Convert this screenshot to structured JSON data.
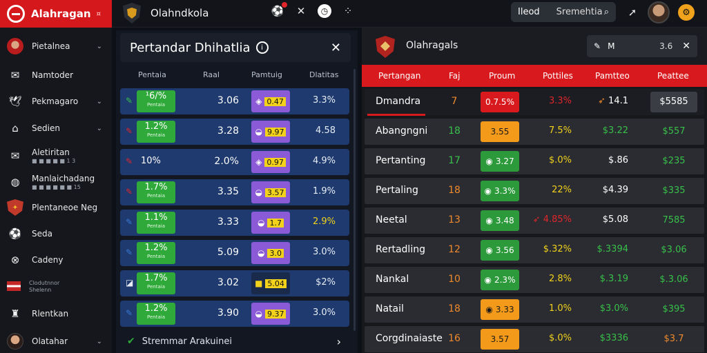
{
  "topbar": {
    "brand": "Alahragan",
    "brand_mark": "¤",
    "app_title": "Olahndkola",
    "search_left": "Ileod",
    "search_right": "Sremehtia"
  },
  "sidebar": {
    "items": [
      {
        "label": "Pietalnea",
        "sub": "",
        "icon": "avatar-icon",
        "chev": "⌄"
      },
      {
        "label": "Namtoder",
        "sub": "",
        "icon": "mail-icon",
        "chev": ""
      },
      {
        "label": "Pekmagaro",
        "sub": "",
        "icon": "bird-icon",
        "chev": "⌄"
      },
      {
        "label": "Sedien",
        "sub": "",
        "icon": "building-icon",
        "chev": "⌄"
      },
      {
        "label": "Aletiritan",
        "sub": "■ ■ ■ ■ ■ 1 3",
        "icon": "mail-icon",
        "chev": ""
      },
      {
        "label": "Manlaichadang",
        "sub": "■ ■ ■ ■ ■ ■ 15",
        "icon": "globe-icon",
        "chev": ""
      },
      {
        "label": "Plentaneoe Neg",
        "sub": "",
        "icon": "shield-icon",
        "chev": ""
      },
      {
        "label": "Seda",
        "sub": "",
        "icon": "soccer-icon",
        "chev": ""
      },
      {
        "label": "Cadeny",
        "sub": "",
        "icon": "cross-icon",
        "chev": ""
      },
      {
        "label": "Clodutnnor",
        "sub": "Shelenn",
        "icon": "flag-icon",
        "chev": ""
      },
      {
        "label": "Rlentkan",
        "sub": "",
        "icon": "chef-icon",
        "chev": ""
      },
      {
        "label": "Olatahar",
        "sub": "",
        "icon": "player-icon",
        "chev": "⌄"
      }
    ]
  },
  "left_panel": {
    "title": "Pertandar Dhihatlia",
    "columns": [
      "Pentaia",
      "Raal",
      "Pamtuig",
      "Dlatitas"
    ],
    "rows": [
      {
        "a": "¹6/%",
        "a_sub": "Pentaia",
        "b": "3.06",
        "c": "0.47",
        "d": "3.3%"
      },
      {
        "a": "1.2%",
        "a_sub": "Pentaia",
        "b": "3.28",
        "c": "9.97",
        "d": "4.58"
      },
      {
        "a": "10%",
        "a_sub": "",
        "b": "2.0%",
        "c": "0.97",
        "d": "4.9%"
      },
      {
        "a": "1.7%",
        "a_sub": "Pentaia",
        "b": "3.35",
        "c": "3.57",
        "d": "1.9%"
      },
      {
        "a": "1.1%",
        "a_sub": "Pentaia",
        "b": "3.33",
        "c": "1.7",
        "d": "2.9%"
      },
      {
        "a": "1.2%",
        "a_sub": "Pentaia",
        "b": "5.09",
        "c": "3.0",
        "d": "3.0%"
      },
      {
        "a": "1.7%",
        "a_sub": "Pentaia",
        "b": "3.02",
        "c": "5.04",
        "d": "$2%"
      },
      {
        "a": "1.2%",
        "a_sub": "Pentaia",
        "b": "3.90",
        "c": "9.37",
        "d": "3.0%"
      }
    ],
    "footer": "Stremmar Arakuinei"
  },
  "right_panel": {
    "title": "Olahragals",
    "search_m": "M",
    "search_value": "3.6",
    "columns": [
      "Pertangan",
      "Faj",
      "Proum",
      "Pottiles",
      "Pamtteo",
      "Peattee"
    ],
    "rows": [
      {
        "name": "Dmandra",
        "n": "7",
        "box": "0.7.5%",
        "box_style": "red",
        "c4": "3.3%",
        "c5": "14.1",
        "c6": "$5585"
      },
      {
        "name": "Abangngni",
        "n": "18",
        "box": "3.55",
        "box_style": "orange",
        "c4": "7.5%",
        "c5": "$3.22",
        "c6": "$557"
      },
      {
        "name": "Pertanting",
        "n": "17",
        "box": "3.27",
        "box_style": "green",
        "c4": "$.0%",
        "c5": "$.86",
        "c6": "$235"
      },
      {
        "name": "Pertaling",
        "n": "18",
        "box": "3.3%",
        "box_style": "green",
        "c4": "22%",
        "c5": "$4.39",
        "c6": "$335"
      },
      {
        "name": "Neetal",
        "n": "13",
        "box": "3.48",
        "box_style": "green",
        "c4": "4.85%",
        "c5": "$5.08",
        "c6": "7585"
      },
      {
        "name": "Rertadling",
        "n": "12",
        "box": "3.56",
        "box_style": "green",
        "c4": "$.32%",
        "c5": "$.3394",
        "c6": "$3.06"
      },
      {
        "name": "Nankal",
        "n": "10",
        "box": "2.3%",
        "box_style": "green",
        "c4": "2.8%",
        "c5": "$.3.19",
        "c6": "$.3.06"
      },
      {
        "name": "Natail",
        "n": "18",
        "box": "3.33",
        "box_style": "orange",
        "c4": "1.0%",
        "c5": "$3.0%",
        "c6": "$395"
      },
      {
        "name": "Corgdinaiaste",
        "n": "16",
        "box": "3.57",
        "box_style": "orange",
        "c4": "$.0%",
        "c5": "$3336",
        "c6": "$3.7"
      }
    ]
  }
}
